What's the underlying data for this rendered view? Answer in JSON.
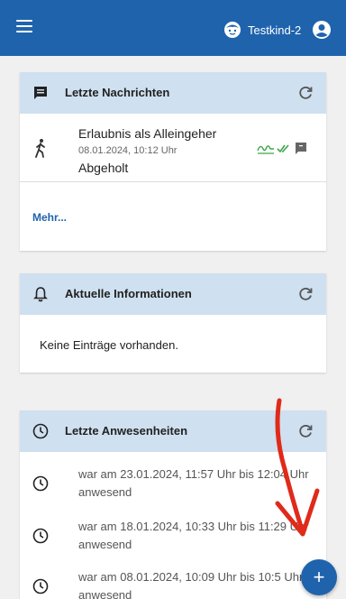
{
  "header": {
    "child_name": "Testkind-2",
    "icons": {
      "menu": "menu-icon",
      "child": "child-face-icon",
      "account": "account-icon"
    }
  },
  "messages_card": {
    "title": "Letzte Nachrichten",
    "item": {
      "title": "Erlaubnis als Alleingeher",
      "date": "08.01.2024, 10:12 Uhr",
      "status": "Abgeholt"
    },
    "more_label": "Mehr..."
  },
  "info_card": {
    "title": "Aktuelle Informationen",
    "empty_text": "Keine Einträge vorhanden."
  },
  "attendance_card": {
    "title": "Letzte Anwesenheiten",
    "items": [
      {
        "text": "war am 23.01.2024, 11:57 Uhr bis 12:04 Uhr anwesend"
      },
      {
        "text": "war am 18.01.2024, 10:33 Uhr bis 11:29 Uhr anwesend"
      },
      {
        "text": "war am 08.01.2024, 10:09 Uhr bis 10:5 Uhr anwesend"
      }
    ]
  },
  "colors": {
    "primary": "#1f63ad",
    "card_header": "#cfe0f0",
    "check_green": "#3aa84a",
    "annotation_red": "#e02a1a"
  }
}
